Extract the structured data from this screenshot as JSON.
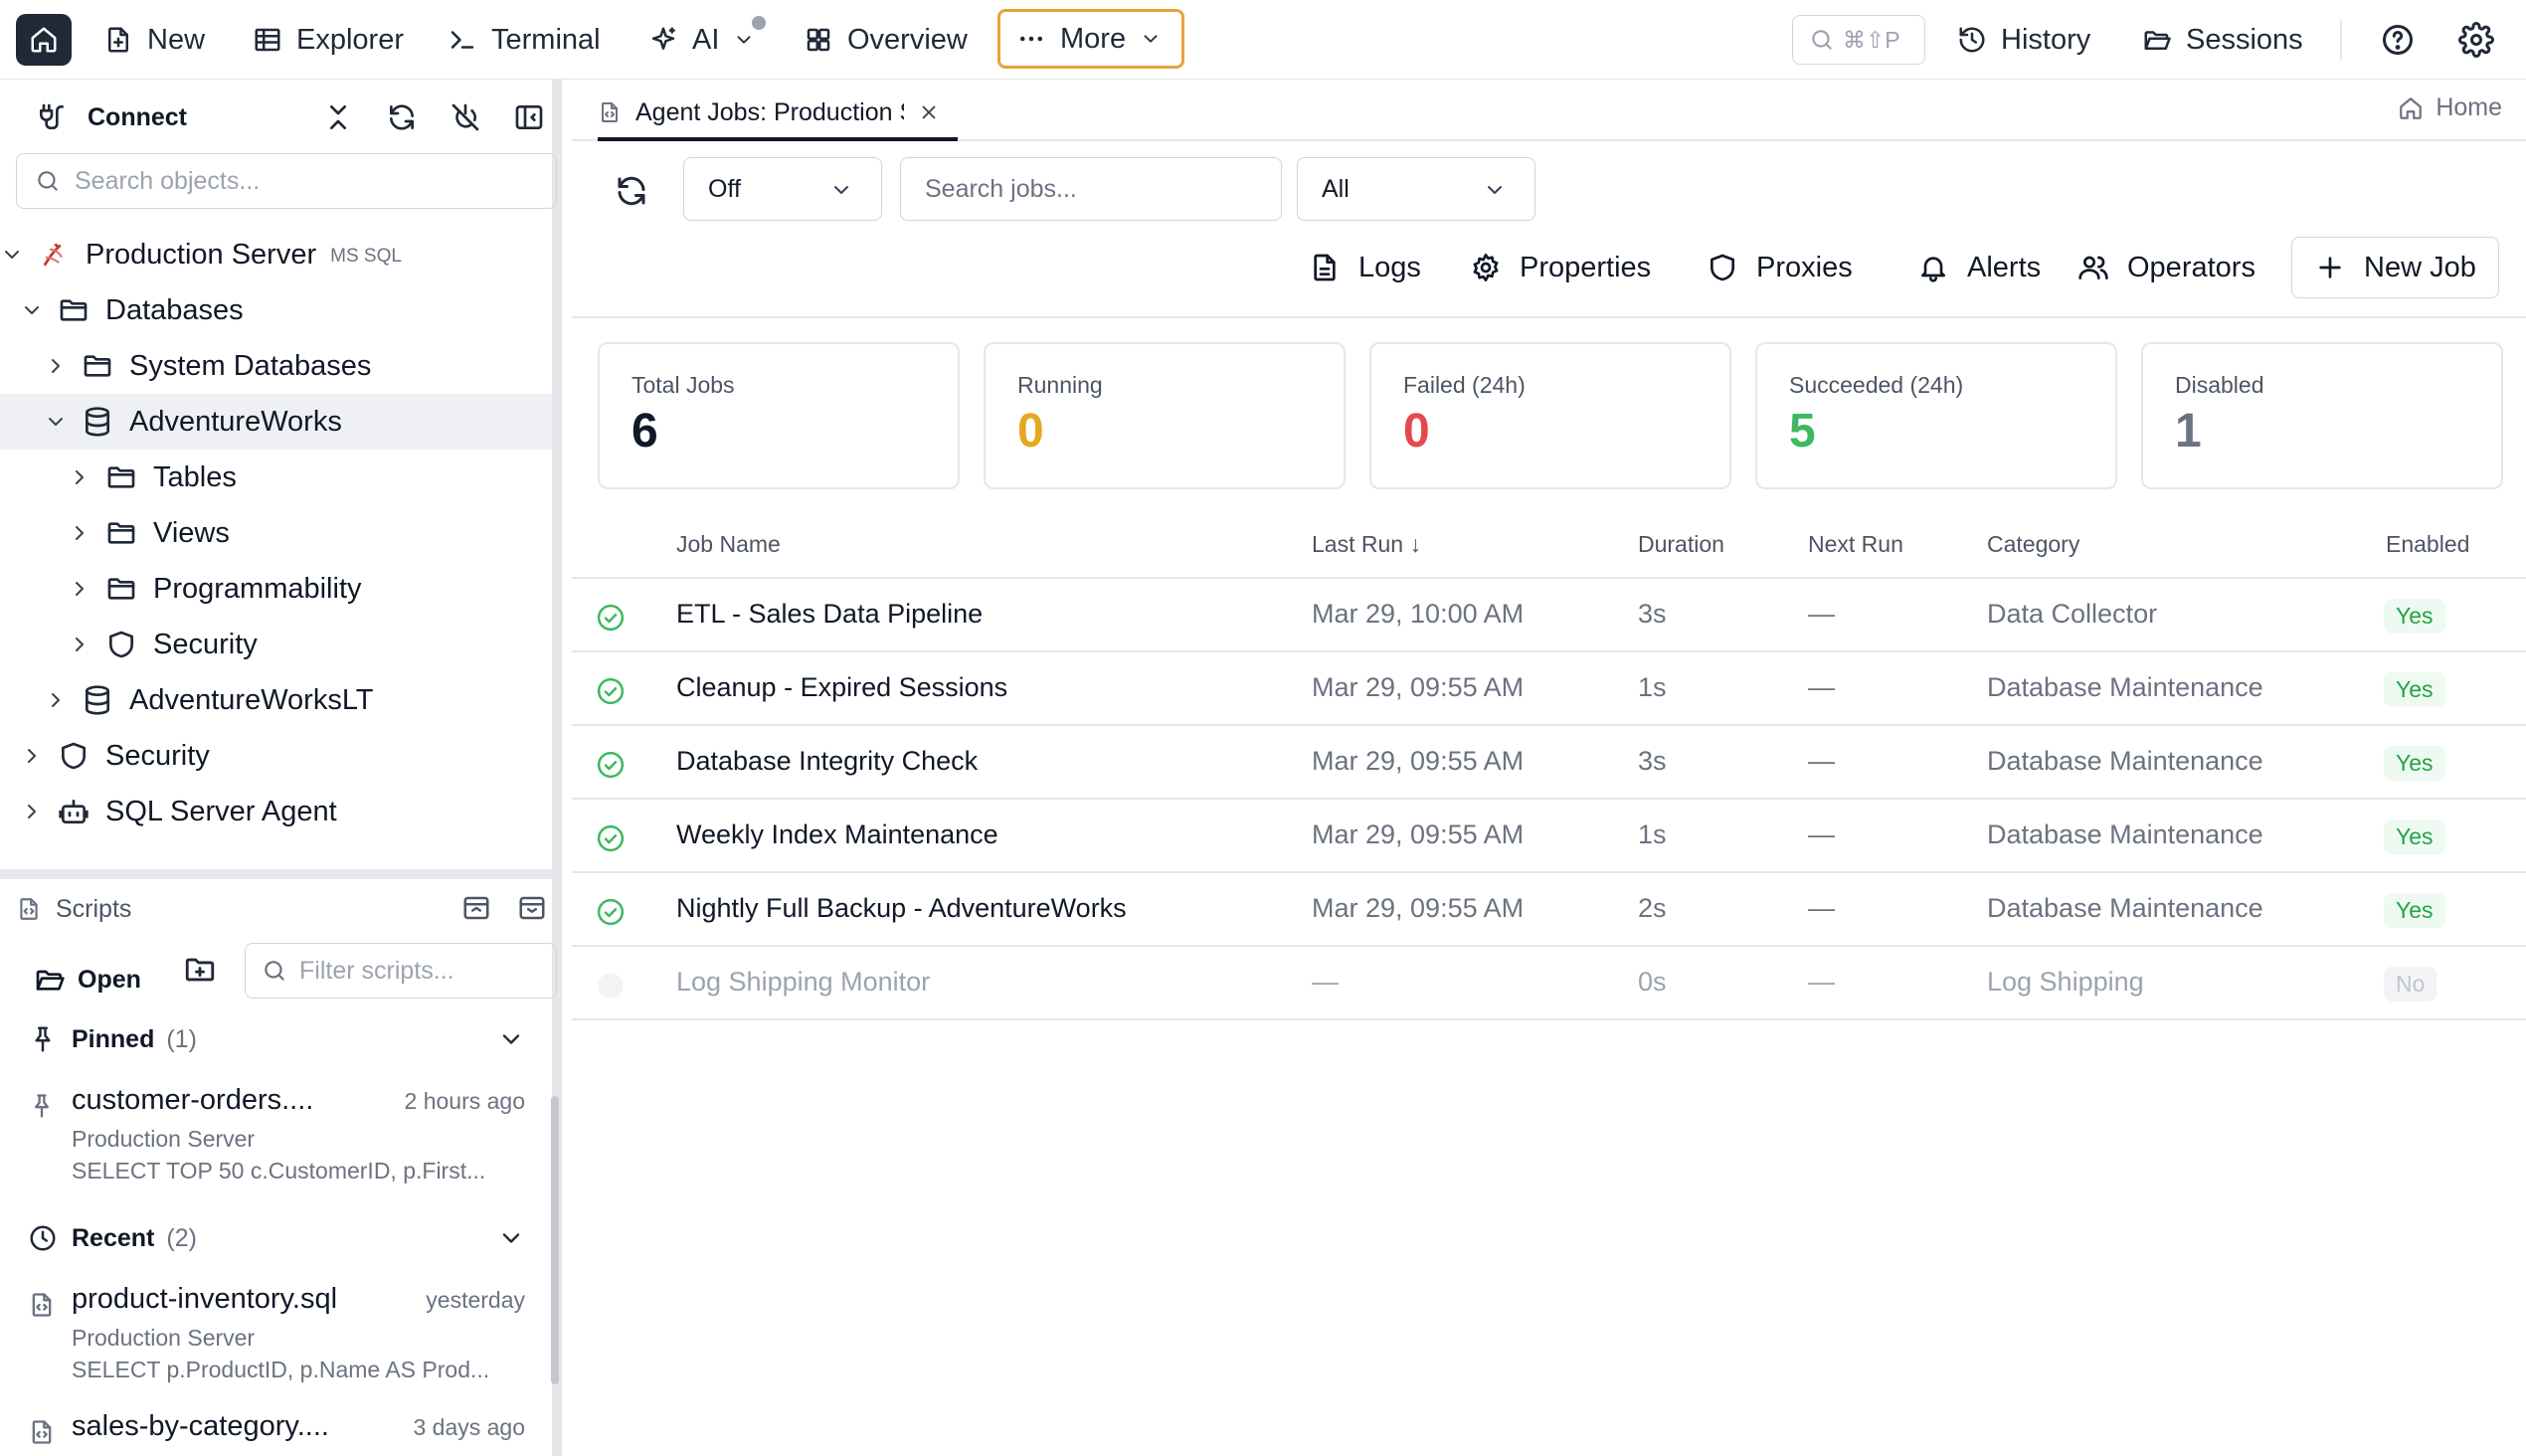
{
  "topbar": {
    "items": {
      "new": "New",
      "explorer": "Explorer",
      "terminal": "Terminal",
      "ai": "AI",
      "overview": "Overview",
      "more": "More"
    },
    "search_shortcut": "⌘⇧P",
    "history": "History",
    "sessions": "Sessions"
  },
  "sidebar": {
    "connect_label": "Connect",
    "search_placeholder": "Search objects...",
    "tree": {
      "server": "Production Server",
      "server_type": "MS SQL",
      "databases": "Databases",
      "system_databases": "System Databases",
      "adventureworks": "AdventureWorks",
      "tables": "Tables",
      "views": "Views",
      "programmability": "Programmability",
      "db_security": "Security",
      "adventureworkslt": "AdventureWorksLT",
      "security": "Security",
      "agent": "SQL Server Agent"
    },
    "scripts": {
      "title": "Scripts",
      "open": "Open",
      "filter_placeholder": "Filter scripts...",
      "pinned_label": "Pinned",
      "pinned_count": "(1)",
      "recent_label": "Recent",
      "recent_count": "(2)",
      "pinned": [
        {
          "name": "customer-orders....",
          "time": "2 hours ago",
          "server": "Production Server",
          "sql": "SELECT TOP 50 c.CustomerID, p.First..."
        }
      ],
      "recent": [
        {
          "name": "product-inventory.sql",
          "time": "yesterday",
          "server": "Production Server",
          "sql": "SELECT p.ProductID, p.Name AS Prod..."
        },
        {
          "name": "sales-by-category....",
          "time": "3 days ago"
        }
      ]
    }
  },
  "tab": {
    "label": "Agent Jobs: Production Server",
    "home": "Home"
  },
  "toolbar": {
    "refresh_interval": "Off",
    "search_placeholder": "Search jobs...",
    "filter": "All",
    "logs": "Logs",
    "properties": "Properties",
    "proxies": "Proxies",
    "alerts": "Alerts",
    "operators": "Operators",
    "new_job": "New Job"
  },
  "stats": {
    "total_label": "Total Jobs",
    "total": "6",
    "running_label": "Running",
    "running": "0",
    "failed_label": "Failed (24h)",
    "failed": "0",
    "succeeded_label": "Succeeded (24h)",
    "succeeded": "5",
    "disabled_label": "Disabled",
    "disabled": "1",
    "colors": {
      "running": "#e4a81d",
      "failed": "#e5484d",
      "succeeded": "#3fb862",
      "disabled": "#6b7280"
    }
  },
  "table": {
    "headers": {
      "job_name": "Job Name",
      "last_run": "Last Run ↓",
      "duration": "Duration",
      "next_run": "Next Run",
      "category": "Category",
      "enabled": "Enabled"
    },
    "rows": [
      {
        "name": "ETL - Sales Data Pipeline",
        "last_run": "Mar 29, 10:00 AM",
        "duration": "3s",
        "next_run": "—",
        "category": "Data Collector",
        "enabled": "Yes",
        "status": "success-icon"
      },
      {
        "name": "Cleanup - Expired Sessions",
        "last_run": "Mar 29, 09:55 AM",
        "duration": "1s",
        "next_run": "—",
        "category": "Database Maintenance",
        "enabled": "Yes",
        "status": "success-icon"
      },
      {
        "name": "Database Integrity Check",
        "last_run": "Mar 29, 09:55 AM",
        "duration": "3s",
        "next_run": "—",
        "category": "Database Maintenance",
        "enabled": "Yes",
        "status": "success-icon"
      },
      {
        "name": "Weekly Index Maintenance",
        "last_run": "Mar 29, 09:55 AM",
        "duration": "1s",
        "next_run": "—",
        "category": "Database Maintenance",
        "enabled": "Yes",
        "status": "success-icon"
      },
      {
        "name": "Nightly Full Backup - AdventureWorks",
        "last_run": "Mar 29, 09:55 AM",
        "duration": "2s",
        "next_run": "—",
        "category": "Database Maintenance",
        "enabled": "Yes",
        "status": "success-icon"
      },
      {
        "name": "Log Shipping Monitor",
        "last_run": "—",
        "duration": "0s",
        "next_run": "—",
        "category": "Log Shipping",
        "enabled": "No",
        "status": "idle-icon"
      }
    ]
  }
}
